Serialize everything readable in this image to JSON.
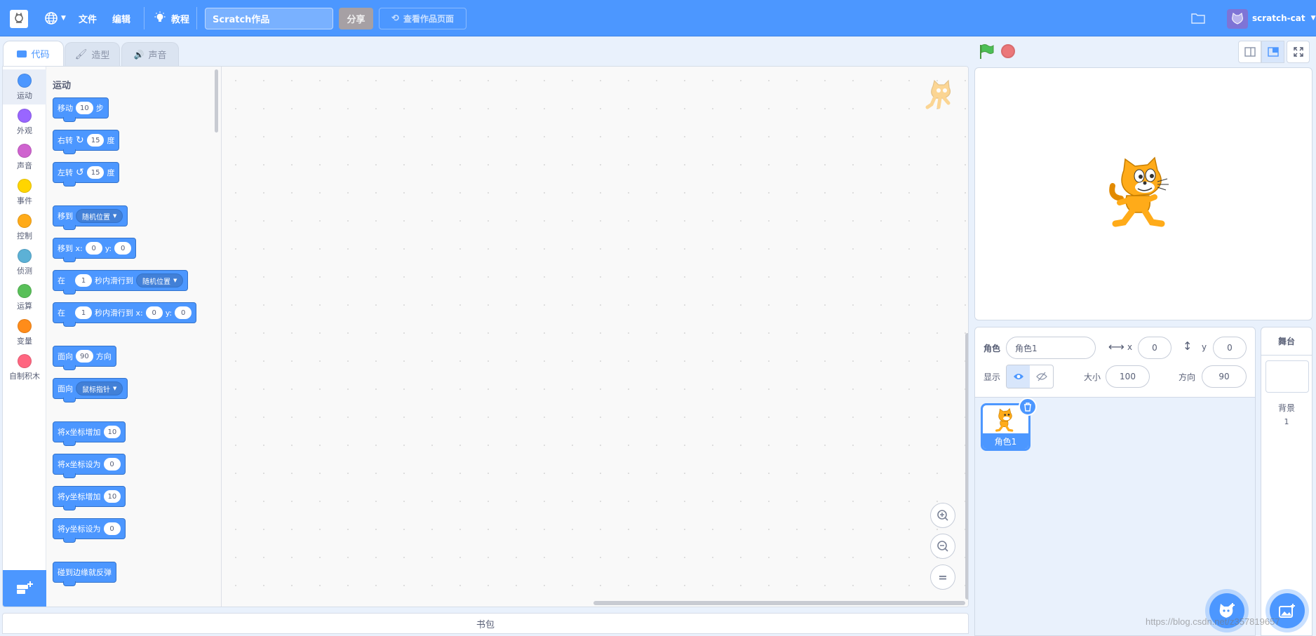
{
  "menubar": {
    "file": "文件",
    "edit": "编辑",
    "tutorial": "教程",
    "project_title": "Scratch作品",
    "share": "分享",
    "see_project_page": "查看作品页面",
    "username": "scratch-cat"
  },
  "tabs": {
    "code": "代码",
    "costumes": "造型",
    "sounds": "声音"
  },
  "categories": [
    {
      "label": "运动",
      "color": "#4c97ff"
    },
    {
      "label": "外观",
      "color": "#9966ff"
    },
    {
      "label": "声音",
      "color": "#cf63cf"
    },
    {
      "label": "事件",
      "color": "#ffd500"
    },
    {
      "label": "控制",
      "color": "#ffab19"
    },
    {
      "label": "侦测",
      "color": "#5cb1d6"
    },
    {
      "label": "运算",
      "color": "#59c059"
    },
    {
      "label": "变量",
      "color": "#ff8c1a"
    },
    {
      "label": "自制积木",
      "color": "#ff6680"
    }
  ],
  "palette": {
    "title": "运动",
    "move": {
      "t1": "移动",
      "v": "10",
      "t2": "步"
    },
    "turn_right": {
      "t1": "右转",
      "v": "15",
      "t2": "度"
    },
    "turn_left": {
      "t1": "左转",
      "v": "15",
      "t2": "度"
    },
    "goto": {
      "t1": "移到",
      "menu": "随机位置"
    },
    "goto_xy": {
      "t1": "移到 x:",
      "x": "0",
      "t2": "y:",
      "y": "0"
    },
    "glide": {
      "t1": "在",
      "v": "1",
      "t2": "秒内滑行到",
      "menu": "随机位置"
    },
    "glide_xy": {
      "t1": "在",
      "v": "1",
      "t2": "秒内滑行到 x:",
      "x": "0",
      "t3": "y:",
      "y": "0"
    },
    "point_dir": {
      "t1": "面向",
      "v": "90",
      "t2": "方向"
    },
    "point_towards": {
      "t1": "面向",
      "menu": "鼠标指针"
    },
    "change_x": {
      "t1": "将x坐标增加",
      "v": "10"
    },
    "set_x": {
      "t1": "将x坐标设为",
      "v": "0"
    },
    "change_y": {
      "t1": "将y坐标增加",
      "v": "10"
    },
    "set_y": {
      "t1": "将y坐标设为",
      "v": "0"
    },
    "bounce": {
      "t1": "碰到边缘就反弹"
    }
  },
  "backpack": "书包",
  "sprite_info": {
    "sprite_label": "角色",
    "sprite_name": "角色1",
    "x_label": "x",
    "x_value": "0",
    "y_label": "y",
    "y_value": "0",
    "show_label": "显示",
    "size_label": "大小",
    "size_value": "100",
    "direction_label": "方向",
    "direction_value": "90"
  },
  "sprites": [
    {
      "name": "角色1"
    }
  ],
  "stage_pane": {
    "title": "舞台",
    "backdrops_label": "背景",
    "backdrops_count": "1"
  },
  "watermark": "https://blog.csdn.net/z357819657"
}
